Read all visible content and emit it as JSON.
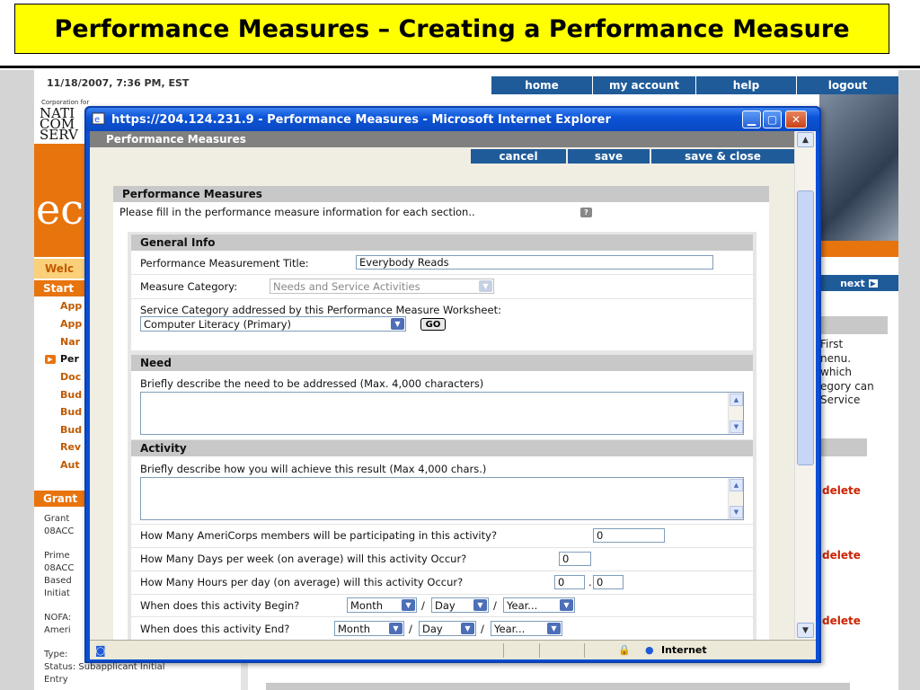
{
  "slide": {
    "title": "Performance Measures – Creating a Performance Measure"
  },
  "colors": {
    "title_bg": "#ffff00",
    "nav_blue": "#1f5b99",
    "orange": "#e8740d",
    "delete_red": "#cc2200",
    "section_gray": "#c8c8c8"
  },
  "background_page": {
    "datetime": "11/18/2007, 7:36 PM, EST",
    "nav": [
      "home",
      "my account",
      "help",
      "logout"
    ],
    "logo_small": "Corporation for",
    "logo_lines": [
      "NATI",
      "COM",
      "SERV"
    ],
    "logo_big_letters": "ec",
    "welcome": "Welc",
    "start_head": "Start",
    "side_items": [
      "App",
      "App",
      "Nar",
      "Per",
      "Doc",
      "Bud",
      "Bud",
      "Bud",
      "Rev",
      "Aut"
    ],
    "grant_head": "Grant",
    "grant_lines": [
      "Grant",
      "08ACC"
    ],
    "prime_lines": [
      "Prime",
      "08ACC",
      "Based",
      "Initiat"
    ],
    "nofa_lines": [
      "NOFA:",
      "Ameri"
    ],
    "type_line": "Type:",
    "status_line": "Status: Subapplicant Initial",
    "entry_line": "Entry",
    "next_label": "next",
    "right_text": [
      "First",
      "nenu.",
      "which",
      "egory can",
      "Service"
    ],
    "delete_label": "delete"
  },
  "popup": {
    "title": "https://204.124.231.9 - Performance Measures - Microsoft Internet Explorer",
    "header": "Performance Measures",
    "actions": {
      "cancel": "cancel",
      "save": "save",
      "save_close": "save & close"
    },
    "intro_title": "Performance Measures",
    "intro_text": "Please fill in the performance measure information for each section..",
    "help_icon": "?",
    "general": {
      "title": "General Info",
      "pm_title_label": "Performance Measurement Title:",
      "pm_title_value": "Everybody Reads",
      "category_label": "Measure Category:",
      "category_value": "Needs and Service Activities",
      "service_label": "Service Category addressed by this Performance Measure Worksheet:",
      "service_value": "Computer Literacy (Primary)",
      "go_label": "GO"
    },
    "need": {
      "title": "Need",
      "label": "Briefly describe the need to be addressed (Max. 4,000 characters)"
    },
    "activity": {
      "title": "Activity",
      "label": "Briefly describe how you will achieve this result (Max 4,000 chars.)",
      "members_label": "How Many AmeriCorps members will be participating in this activity?",
      "members_value": "0",
      "days_label": "How Many Days per week (on average) will this activity Occur?",
      "days_value": "0",
      "hours_label": "How Many Hours per day (on average) will this activity Occur?",
      "hours_value": "0",
      "hours_fraction": "0",
      "hours_sep": ".",
      "begin_label": "When does this activity Begin?",
      "end_label": "When does this activity End?",
      "month": "Month",
      "day": "Day",
      "year": "Year...",
      "slash": "/"
    },
    "status": {
      "zone": "Internet"
    }
  }
}
